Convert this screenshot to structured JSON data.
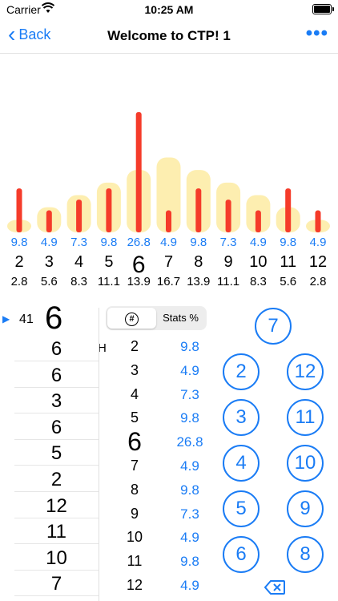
{
  "status_bar": {
    "carrier": "Carrier",
    "time": "10:25 AM"
  },
  "nav": {
    "back_label": "Back",
    "title": "Welcome to CTP! 1",
    "more_label": "•••"
  },
  "chart_data": {
    "type": "bar",
    "categories": [
      "2",
      "3",
      "4",
      "5",
      "6",
      "7",
      "8",
      "9",
      "10",
      "11",
      "12"
    ],
    "highlight": "6",
    "series": [
      {
        "name": "",
        "role": "actual %",
        "color": "#f53b2a",
        "values": [
          9.8,
          4.9,
          7.3,
          9.8,
          26.8,
          4.9,
          9.8,
          7.3,
          4.9,
          9.8,
          4.9
        ]
      },
      {
        "name": "",
        "role": "expected %",
        "color": "#fdeeb0",
        "values": [
          2.8,
          5.6,
          8.3,
          11.1,
          13.9,
          16.7,
          13.9,
          11.1,
          8.3,
          5.6,
          2.8
        ]
      }
    ],
    "top_labels": [
      "9.8",
      "4.9",
      "7.3",
      "9.8",
      "26.8",
      "4.9",
      "9.8",
      "7.3",
      "4.9",
      "9.8",
      "4.9"
    ],
    "bottom_labels": [
      "2.8",
      "5.6",
      "8.3",
      "11.1",
      "13.9",
      "16.7",
      "13.9",
      "11.1",
      "8.3",
      "5.6",
      "2.8"
    ],
    "xlabel": "",
    "ylabel": "",
    "grid": false
  },
  "history": {
    "count": "41",
    "current": "6",
    "rows": [
      {
        "value": "6",
        "flag": "H"
      },
      {
        "value": "6",
        "flag": ""
      },
      {
        "value": "3",
        "flag": ""
      },
      {
        "value": "6",
        "flag": ""
      },
      {
        "value": "5",
        "flag": ""
      },
      {
        "value": "2",
        "flag": ""
      },
      {
        "value": "12",
        "flag": ""
      },
      {
        "value": "11",
        "flag": ""
      },
      {
        "value": "10",
        "flag": ""
      },
      {
        "value": "7",
        "flag": ""
      }
    ]
  },
  "stats": {
    "segment": {
      "hash_label": "#",
      "stats_label": "Stats %"
    },
    "rows": [
      {
        "key": "2",
        "pct": "9.8"
      },
      {
        "key": "3",
        "pct": "4.9"
      },
      {
        "key": "4",
        "pct": "7.3"
      },
      {
        "key": "5",
        "pct": "9.8"
      },
      {
        "key": "6",
        "pct": "26.8"
      },
      {
        "key": "7",
        "pct": "4.9"
      },
      {
        "key": "8",
        "pct": "9.8"
      },
      {
        "key": "9",
        "pct": "7.3"
      },
      {
        "key": "10",
        "pct": "4.9"
      },
      {
        "key": "11",
        "pct": "9.8"
      },
      {
        "key": "12",
        "pct": "4.9"
      }
    ]
  },
  "keypad": {
    "top": "7",
    "left": [
      "2",
      "3",
      "4",
      "5",
      "6"
    ],
    "right": [
      "12",
      "11",
      "10",
      "9",
      "8"
    ]
  }
}
